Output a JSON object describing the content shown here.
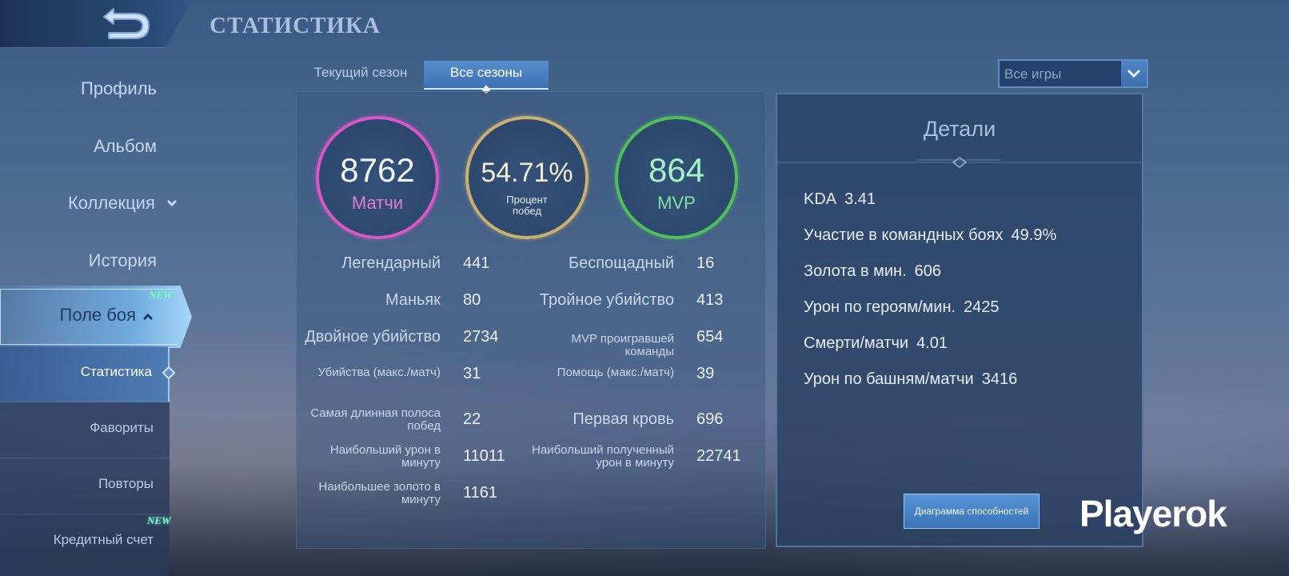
{
  "header": {
    "title": "СТАТИСТИКА"
  },
  "sidebar": {
    "items": [
      {
        "label": "Профиль"
      },
      {
        "label": "Альбом"
      },
      {
        "label": "Коллекция",
        "chevron": "chevron-down"
      },
      {
        "label": "История"
      },
      {
        "label": "Поле боя",
        "chevron": "chevron-up",
        "badge": "NEW",
        "active": true
      }
    ],
    "sub_items": [
      {
        "label": "Статистика",
        "active": true
      },
      {
        "label": "Фавориты"
      },
      {
        "label": "Повторы"
      },
      {
        "label": "Кредитный счет",
        "badge": "NEW"
      }
    ]
  },
  "tabs": [
    {
      "label": "Текущий сезон",
      "active": false
    },
    {
      "label": "Все сезоны",
      "active": true
    }
  ],
  "filter": {
    "selected": "Все игры"
  },
  "summary": {
    "matches": {
      "value": "8762",
      "label": "Матчи",
      "color": "#d857c6"
    },
    "winrate": {
      "value": "54.71%",
      "label_line1": "Процент",
      "label_line2": "побед",
      "color": "#c9b06e"
    },
    "mvp": {
      "value": "864",
      "label": "MVP",
      "color": "#4fbf5c"
    }
  },
  "stats_left": [
    {
      "label": "Легендарный",
      "value": "441"
    },
    {
      "label": "Маньяк",
      "value": "80"
    },
    {
      "label": "Двойное убийство",
      "value": "2734"
    },
    {
      "label": "Убийства (макс./матч)",
      "value": "31"
    },
    {
      "label_line1": "Самая длинная полоса",
      "label_line2": "побед",
      "value": "22"
    },
    {
      "label_line1": "Наибольший урон в",
      "label_line2": "минуту",
      "value": "11011"
    },
    {
      "label_line1": "Наибольшее золото в",
      "label_line2": "минуту",
      "value": "1161"
    }
  ],
  "stats_right": [
    {
      "label": "Беспощадный",
      "value": "16"
    },
    {
      "label": "Тройное убийство",
      "value": "413"
    },
    {
      "label_line1": "MVP проигравшей",
      "label_line2": "команды",
      "value": "654"
    },
    {
      "label": "Помощь (макс./матч)",
      "value": "39"
    },
    {
      "label": "Первая кровь",
      "value": "696"
    },
    {
      "label_line1": "Наибольший полученный",
      "label_line2": "урон в минуту",
      "value": "22741"
    }
  ],
  "details": {
    "title": "Детали",
    "rows": [
      {
        "label": "KDA",
        "value": "3.41"
      },
      {
        "label": "Участие в командных боях",
        "value": "49.9%"
      },
      {
        "label": "Золота в мин.",
        "value": "606"
      },
      {
        "label": "Урон по героям/мин.",
        "value": "2425"
      },
      {
        "label": "Смерти/матчи",
        "value": "4.01"
      },
      {
        "label": "Урон по башням/матчи",
        "value": "3416"
      }
    ],
    "button": "Диаграмма способностей"
  },
  "watermark": "Playerok"
}
